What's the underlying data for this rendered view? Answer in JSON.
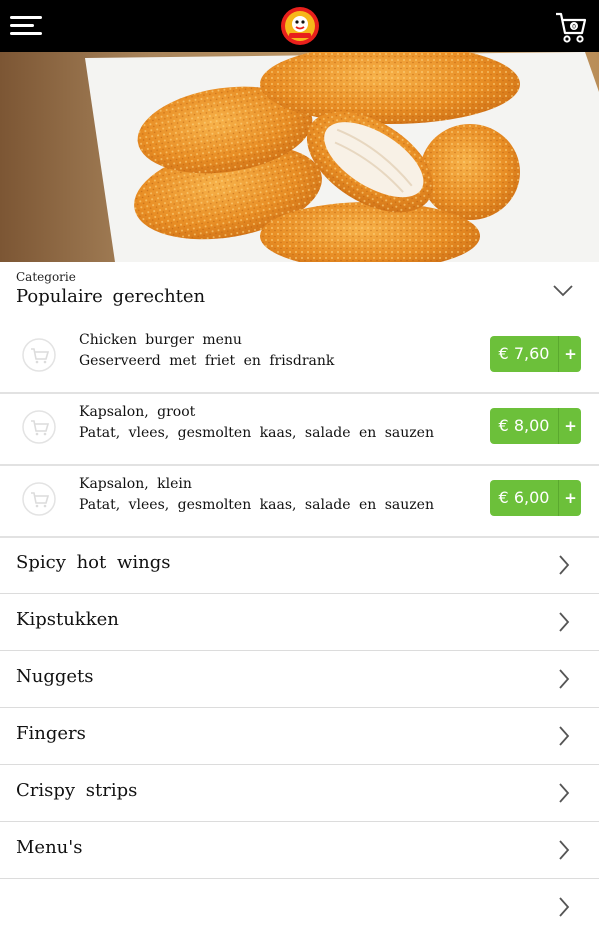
{
  "header": {
    "menu_icon": "hamburger-menu-icon",
    "logo_icon": "restaurant-logo",
    "cart_icon": "shopping-cart-icon",
    "bar_color": "#000000"
  },
  "category": {
    "small_label": "Categorie",
    "title": "Populaire gerechten"
  },
  "products": [
    {
      "name": "Chicken burger menu",
      "description": "Geserveerd met friet en frisdrank",
      "price": "€ 7,60",
      "add": "+"
    },
    {
      "name": "Kapsalon, groot",
      "description": "Patat, vlees, gesmolten kaas, salade en sauzen",
      "price": "€ 8,00",
      "add": "+"
    },
    {
      "name": "Kapsalon, klein",
      "description": "Patat, vlees, gesmolten kaas, salade en sauzen",
      "price": "€ 6,00",
      "add": "+"
    }
  ],
  "categories": [
    {
      "label": "Spicy hot wings"
    },
    {
      "label": "Kipstukken"
    },
    {
      "label": "Nuggets"
    },
    {
      "label": "Fingers"
    },
    {
      "label": "Crispy strips"
    },
    {
      "label": "Menu's"
    }
  ],
  "colors": {
    "accent": "#6cc03a",
    "divider": "#e2e2e2"
  }
}
